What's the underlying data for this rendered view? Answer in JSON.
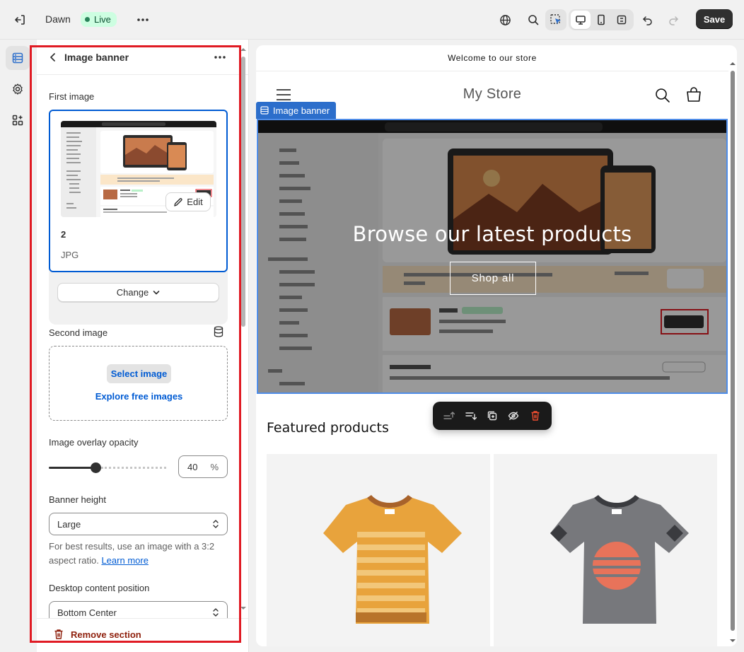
{
  "topbar": {
    "theme_name": "Dawn",
    "status_badge": "Live",
    "save_label": "Save",
    "icons": [
      "exit-icon",
      "more-icon",
      "globe-icon",
      "search-icon",
      "inspector-icon",
      "desktop-icon",
      "mobile-icon",
      "fullscreen-icon",
      "undo-icon",
      "redo-icon"
    ]
  },
  "rail": {
    "items": [
      "sections-icon",
      "settings-gear-icon",
      "apps-icon"
    ]
  },
  "panel": {
    "title": "Image banner",
    "first_image": {
      "label": "First image",
      "edit_label": "Edit",
      "file_name": "2",
      "file_type": "JPG",
      "change_label": "Change"
    },
    "second_image": {
      "label": "Second image",
      "select_label": "Select image",
      "explore_label": "Explore free images"
    },
    "overlay": {
      "label": "Image overlay opacity",
      "value": "40",
      "unit": "%",
      "fraction": 0.4
    },
    "banner_height": {
      "label": "Banner height",
      "value": "Large",
      "hint_text": "For best results, use an image with a 3:2 aspect ratio.",
      "hint_link": "Learn more"
    },
    "desktop_position": {
      "label": "Desktop content position",
      "value": "Bottom Center"
    },
    "remove_label": "Remove section"
  },
  "preview": {
    "announcement": "Welcome to our store",
    "store_name": "My Store",
    "section_tag": "Image banner",
    "banner_heading": "Browse our latest products",
    "banner_button": "Shop all",
    "featured_heading": "Featured products",
    "colors": {
      "accent": "#2c6ecb",
      "tee_orange": "#e8a33c",
      "tee_grey": "#77787c",
      "tee_circle": "#e8735a"
    }
  }
}
